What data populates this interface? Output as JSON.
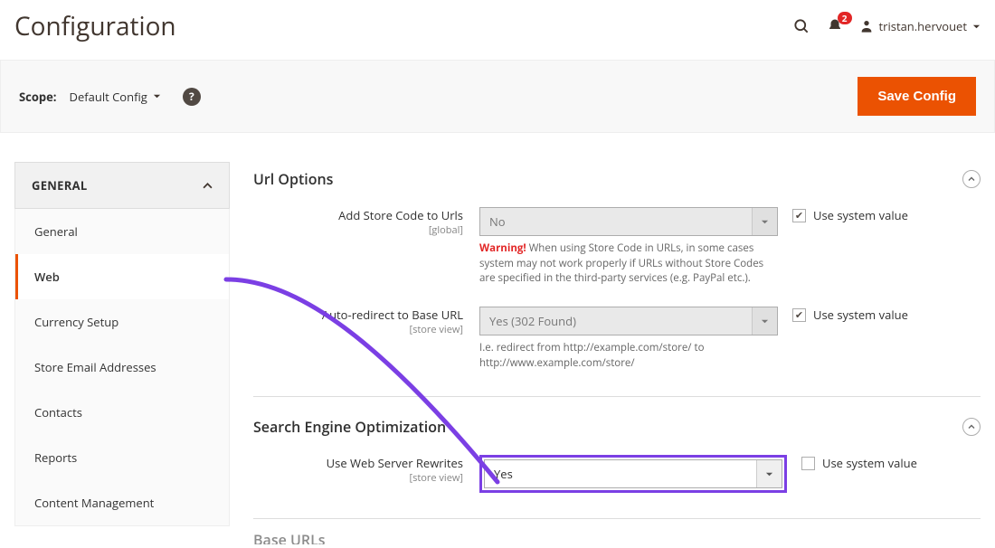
{
  "header": {
    "title": "Configuration",
    "notification_count": "2",
    "username": "tristan.hervouet"
  },
  "scope_bar": {
    "label": "Scope:",
    "selected": "Default Config",
    "save_btn": "Save Config"
  },
  "sidebar": {
    "section_head": "GENERAL",
    "items": [
      {
        "label": "General"
      },
      {
        "label": "Web"
      },
      {
        "label": "Currency Setup"
      },
      {
        "label": "Store Email Addresses"
      },
      {
        "label": "Contacts"
      },
      {
        "label": "Reports"
      },
      {
        "label": "Content Management"
      }
    ]
  },
  "sections": {
    "url_options": {
      "title": "Url Options",
      "fields": {
        "store_code": {
          "label": "Add Store Code to Urls",
          "scope": "[global]",
          "value": "No",
          "note_warn": "Warning!",
          "note_rest": " When using Store Code in URLs, in some cases system may not work properly if URLs without Store Codes are specified in the third-party services (e.g. PayPal etc.).",
          "sys_label": "Use system value"
        },
        "auto_redirect": {
          "label": "Auto-redirect to Base URL",
          "scope": "[store view]",
          "value": "Yes (302 Found)",
          "note": "I.e. redirect from http://example.com/store/ to http://www.example.com/store/",
          "sys_label": "Use system value"
        }
      }
    },
    "seo": {
      "title": "Search Engine Optimization",
      "fields": {
        "rewrites": {
          "label": "Use Web Server Rewrites",
          "scope": "[store view]",
          "value": "Yes",
          "sys_label": "Use system value"
        }
      }
    },
    "base_urls": {
      "title": "Base URLs"
    }
  }
}
